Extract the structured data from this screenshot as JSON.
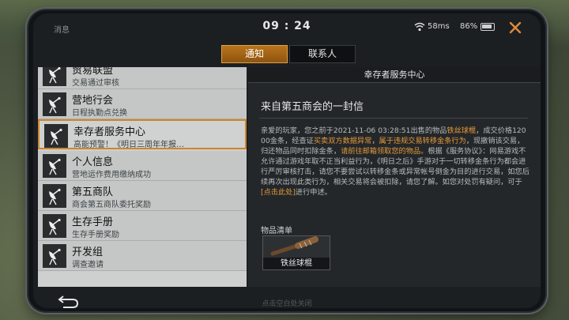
{
  "status": {
    "left_label": "消息",
    "time": "09 : 24",
    "ping": "58ms",
    "battery": "86%"
  },
  "tabs": [
    {
      "label": "通知",
      "active": true
    },
    {
      "label": "联系人",
      "active": false
    }
  ],
  "list": [
    {
      "title": "贸易联盟",
      "subtitle": "交易通过审核"
    },
    {
      "title": "营地行会",
      "subtitle": "日程执勤点兑换"
    },
    {
      "title": "幸存者服务中心",
      "subtitle": "高能预警！《明日三周年年报…",
      "selected": true
    },
    {
      "title": "个人信息",
      "subtitle": "营地运作费用缴纳成功"
    },
    {
      "title": "第五商队",
      "subtitle": "商会第五商队委托奖励"
    },
    {
      "title": "生存手册",
      "subtitle": "生存手册奖励"
    },
    {
      "title": "开发组",
      "subtitle": "调查邀请"
    }
  ],
  "mail": {
    "header": "幸存者服务中心",
    "title": "来自第五商会的一封信",
    "body": [
      {
        "t": "亲爱的玩家，您之前于2021-11-06 03:28:51出售的物品"
      },
      {
        "t": "铁丝球棍",
        "o": true
      },
      {
        "t": "，成交价格12000金条，经查证"
      },
      {
        "t": "买卖双方数据异常",
        "o": true
      },
      {
        "t": "，"
      },
      {
        "t": "属于违规交易转移金条行为",
        "o": true
      },
      {
        "t": "，现撤销该交易，归还物品同时扣除金条，"
      },
      {
        "t": "请前往邮箱领取您的物品。",
        "o": true
      },
      {
        "t": "根据《服务协议》：网易游戏不允许通过游戏年取不正当利益行为，《明日之后》手游对于一切转移金条行为都会进行严厉审核打击，请您不要尝试以转移金条或异常帐号倒金为目的进行交易，如您后续再次出现此类行为，相关交易将会被扣除，请您了解。如您对处罚有疑问，可于"
      },
      {
        "t": "[点击此处]",
        "o": true
      },
      {
        "t": "进行申述。"
      }
    ],
    "goods_label": "物品清单",
    "goods": [
      {
        "name": "铁丝球棍"
      }
    ]
  },
  "footer": {
    "hint": "点击空白处关闭"
  },
  "colors": {
    "accent": "#e39a3a",
    "tab_active": "#b8741c"
  }
}
